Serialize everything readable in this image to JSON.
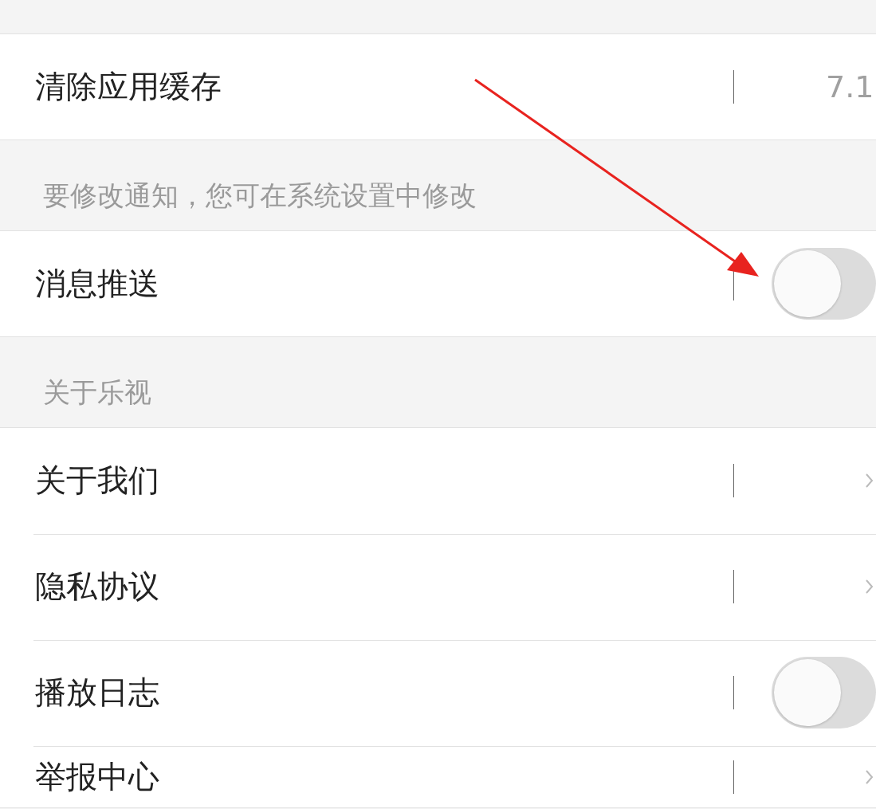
{
  "sections": [
    {
      "rows": [
        {
          "kind": "value",
          "label": "清除应用缓存",
          "value": "7.1"
        }
      ]
    },
    {
      "header": "要修改通知，您可在系统设置中修改",
      "rows": [
        {
          "kind": "toggle",
          "label": "消息推送",
          "on": false
        }
      ]
    },
    {
      "header": "关于乐视",
      "rows": [
        {
          "kind": "link",
          "label": "关于我们"
        },
        {
          "kind": "link",
          "label": "隐私协议"
        },
        {
          "kind": "toggle",
          "label": "播放日志",
          "on": false
        },
        {
          "kind": "link",
          "label": "举报中心"
        }
      ]
    }
  ]
}
